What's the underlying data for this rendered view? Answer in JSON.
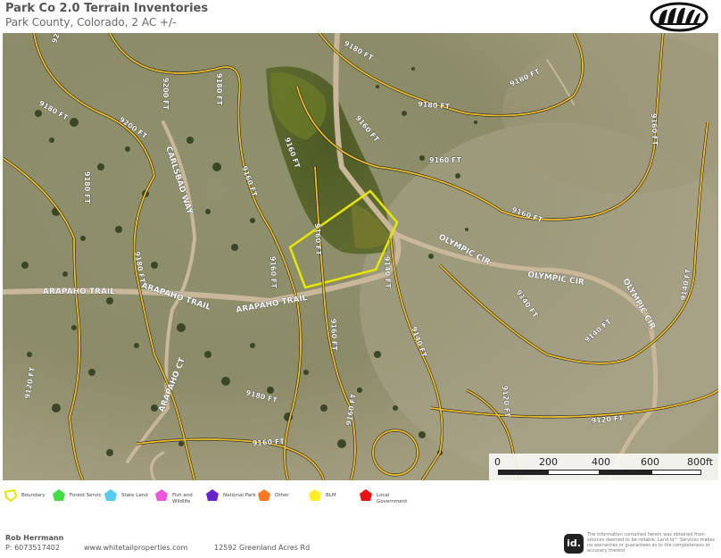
{
  "header": {
    "title": "Park Co 2.0 Terrain Inventories",
    "subtitle": "Park County, Colorado, 2 AC +/-"
  },
  "map": {
    "roads": {
      "carlsbad": "CARLSBAD WAY",
      "arapaho1": "ARAPAHO TRAIL",
      "arapaho2": "ARAPAHO TRAIL",
      "arapaho3": "ARAPAHO TRAIL",
      "olympic1": "OLYMPIC CIR",
      "olympic2": "OLYMPIC CIR",
      "olympic3": "OLYMPIC CIR",
      "arapaho_ct": "ARAPAHO CT"
    },
    "contours": {
      "c9200a": "9200 FT",
      "c9200b": "9200 FT",
      "c9200c": "9200 FT",
      "c9180a": "9180 FT",
      "c9180b": "9180 FT",
      "c9180c": "9180 FT",
      "c9180d": "9180 FT",
      "c9180e": "9180 FT",
      "c9180f": "9180 FT",
      "c9180g": "9180 FT",
      "c9180h": "9180 FT",
      "c9160a": "9160 FT",
      "c9160b": "9160 FT",
      "c9160c": "9160 FT",
      "c9160d": "9160 FT",
      "c9160e": "9160 FT",
      "c9160f": "9160 FT",
      "c9160g": "9160 FT",
      "c9160h": "9160 FT",
      "c9160i": "9160 FT",
      "c9160j": "9160 FT",
      "c9160k": "9160 FT",
      "c9140a": "9140 FT",
      "c9140b": "9140 FT",
      "c9140c": "9140 FT",
      "c9140d": "9140 FT",
      "c9140e": "9140 FT",
      "c9120a": "9120 FT",
      "c9120b": "9120 FT",
      "c9120c": "9120 FT"
    },
    "scale": {
      "ticks": [
        "0",
        "200",
        "400",
        "600",
        "800ft"
      ]
    },
    "colors": {
      "boundary": "#e6e600",
      "contour": "#f2c12e",
      "road": "#c9b79a"
    }
  },
  "legend": {
    "items": [
      {
        "label": "Boundary",
        "color": "#e6e600"
      },
      {
        "label": "Forest Servic",
        "color": "#44dd44"
      },
      {
        "label": "State Land",
        "color": "#55ccee"
      },
      {
        "label": "Fish and Wildlife",
        "color": "#ee55dd"
      },
      {
        "label": "National Park",
        "color": "#6622cc"
      },
      {
        "label": "Other",
        "color": "#ff7722"
      },
      {
        "label": "BLM",
        "color": "#ffee22"
      },
      {
        "label": "Local Government",
        "color": "#ee1111"
      }
    ]
  },
  "footer": {
    "agent_name": "Rob Herrmann",
    "agent_phone": "P: 6073517402",
    "website": "www.whitetailproperties.com",
    "address": "12592 Greenland Acres Rd",
    "id_logo": "id.",
    "disclaimer": "The information contained herein was obtained from sources deemed to be reliable. Land id™ Services makes no warranties or guarantees as to the completeness or accuracy thereof."
  }
}
